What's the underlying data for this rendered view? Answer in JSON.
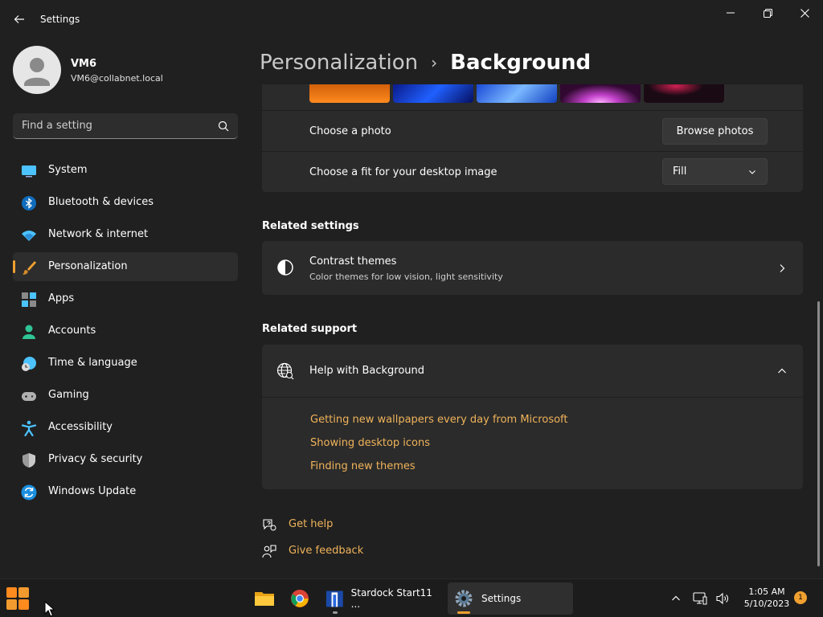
{
  "window": {
    "title": "Settings"
  },
  "profile": {
    "name": "VM6",
    "email": "VM6@collabnet.local"
  },
  "search": {
    "placeholder": "Find a setting"
  },
  "sidebar": {
    "items": [
      {
        "label": "System",
        "icon": "monitor-icon"
      },
      {
        "label": "Bluetooth & devices",
        "icon": "bluetooth-icon"
      },
      {
        "label": "Network & internet",
        "icon": "wifi-icon"
      },
      {
        "label": "Personalization",
        "icon": "brush-icon",
        "active": true
      },
      {
        "label": "Apps",
        "icon": "apps-icon"
      },
      {
        "label": "Accounts",
        "icon": "person-icon"
      },
      {
        "label": "Time & language",
        "icon": "globe-clock-icon"
      },
      {
        "label": "Gaming",
        "icon": "gamepad-icon"
      },
      {
        "label": "Accessibility",
        "icon": "accessibility-icon"
      },
      {
        "label": "Privacy & security",
        "icon": "shield-icon"
      },
      {
        "label": "Windows Update",
        "icon": "update-icon"
      }
    ]
  },
  "breadcrumb": {
    "parent": "Personalization",
    "separator": "›",
    "current": "Background"
  },
  "background": {
    "choose_photo_label": "Choose a photo",
    "browse_button": "Browse photos",
    "fit_label": "Choose a fit for your desktop image",
    "fit_value": "Fill"
  },
  "related_settings": {
    "title": "Related settings",
    "contrast_title": "Contrast themes",
    "contrast_desc": "Color themes for low vision, light sensitivity"
  },
  "related_support": {
    "title": "Related support",
    "help_title": "Help with Background",
    "links": [
      "Getting new wallpapers every day from Microsoft",
      "Showing desktop icons",
      "Finding new themes"
    ]
  },
  "footer_links": {
    "get_help": "Get help",
    "give_feedback": "Give feedback"
  },
  "taskbar": {
    "stardock_label": "Stardock Start11 ...",
    "settings_label": "Settings",
    "time": "1:05 AM",
    "date": "5/10/2023",
    "notification_count": "1"
  },
  "colors": {
    "accent": "#f0a030",
    "link": "#f0b35a",
    "background": "#202020",
    "card": "#2b2b2b"
  }
}
